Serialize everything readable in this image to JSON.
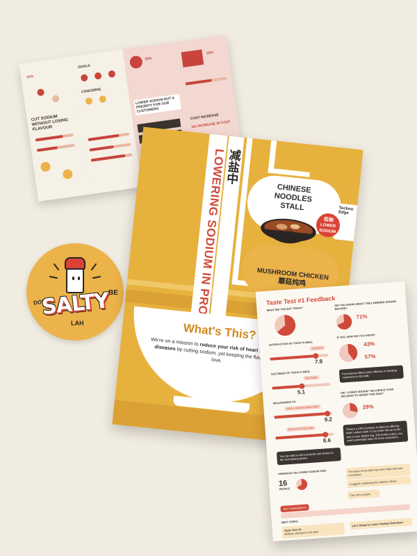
{
  "brochure": {
    "title": "CUT SODIUM WITHOUT LOSING FLAVOUR",
    "goals_label": "GOALS",
    "concerns_label": "CONCERNS",
    "banner": "LOWER SODIUM BUT A PRIORITY FOR OUR CUSTOMERS",
    "cost_label": "COST INCREASE",
    "cost_note": "NO INCREASE IN COST",
    "pct_a": "31%",
    "pct_b": "20%",
    "pct_c": "20%"
  },
  "sticker": {
    "dont": "DON'T",
    "be": "BE",
    "salty": "SALTY",
    "lah": "LAH"
  },
  "poster": {
    "vertical_title": "LOWERING SODIUM IN PROGRESS",
    "chinese_title": "减盐中",
    "stall_line1": "CHINESE",
    "stall_line2": "NOODLES",
    "stall_line3": "STALL",
    "tag": "Techno Edge",
    "badge_cn": "低钠",
    "badge_en1": "LOWER",
    "badge_en2": "SODIUM",
    "dish_en": "MUSHROOM CHICKEN",
    "dish_cn": "蘑菇炖鸡",
    "heading": "What's This?",
    "body_start": "We're on a mission to ",
    "body_bold": "reduce your risk of heart and kidney diseases",
    "body_end": " by cutting sodium, yet keeping the flavours you love."
  },
  "sheet": {
    "title": "Taste Test #1 Feedback",
    "q_salt": "WHAT DID YOU EAT TODAY?",
    "q_know": "DID YOU KNOW ABOUT THE LOWERED SODIUM BEFORE?",
    "know_pct": "71%",
    "q_satisfaction": "SATISFACTION OF TODAY'S MEAL",
    "satisfaction_bubble": "Very Nice!",
    "satisfaction": "7.8",
    "satisfaction_frac": 0.78,
    "q_saltiness": "SALTINESS OF TODAY'S MEAL",
    "saltiness_bubble": "Just Right!",
    "saltiness": "5.1",
    "saltiness_frac": 0.51,
    "q_noticed": "IF YES, HOW DID YOU KNOW?",
    "noticed_a": "43%",
    "noticed_b": "57%",
    "promo_note": "Promotional efforts were effective in bringing customers to the stall.",
    "q_influence": "DID \"LOWER SODIUM\" INFLUENCE YOUR DECISION TO ORDER THIS DISH?",
    "influence_pct": "29%",
    "q_willingness": "WILLINGNESS TO",
    "will_a_bubble": "Will try reduced sodium dish!",
    "will_a": "9.2",
    "will_a_frac": 0.92,
    "will_b_bubble": "Shift over for less salty",
    "will_b": "8.6",
    "will_b_frac": 0.86,
    "dark_note": "There's a 29% increase in sales by offering lower sodium dish. If you scale this up to the rest of your dishes (eg. 300 bowls a day), you could potentially have 30 more customers.",
    "dark_note2": "You can talk to sell a reduced salt version in the next tasting phase.",
    "q_feedback": "FEEDBACK ON LOWER SODIUM DISH",
    "people": "16",
    "people_label": "PEOPLE",
    "feedback_1": "The taste of the dish has been kept and was consistent.",
    "feedback_2": "I suggest continuing the balance flavor.",
    "feedback_3": "Can retry a gain!",
    "takeaway_label": "KEY TAKEAWAYS",
    "next_label": "NEXT STEPS",
    "next_1_title": "Taste Test #2",
    "next_1_body": "Without changes to the dish",
    "next_2_title": "Let's Swap to Lower Sodium Salt Now!"
  },
  "colors": {
    "background": "#f1ece1",
    "poster_yellow": "#e7b13e",
    "accent_red": "#cf4a3a",
    "dark": "#2e2926"
  }
}
